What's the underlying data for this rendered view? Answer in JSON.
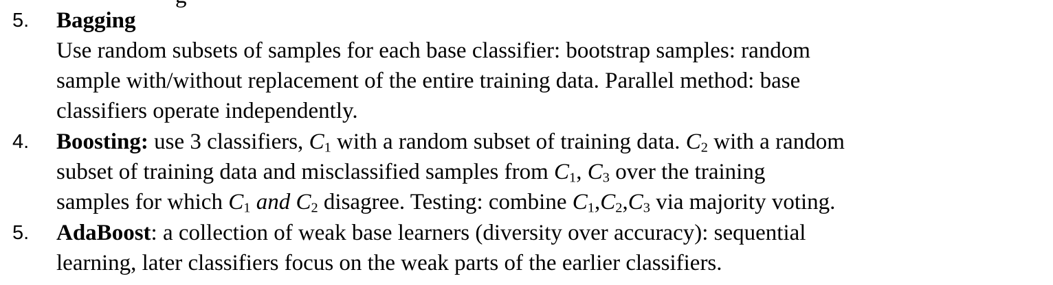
{
  "fragment": "g",
  "items": [
    {
      "number": "5.",
      "title": "Bagging",
      "lines": [
        "Use random subsets of samples for each base classifier: bootstrap samples: random",
        "sample with/without replacement of the entire training data. Parallel method: base",
        "classifiers operate independently."
      ]
    },
    {
      "number": "4.",
      "title": "Boosting:",
      "line1_text_a": " use 3 classifiers, ",
      "c": "C",
      "s1": "1",
      "s2": "2",
      "s3": "3",
      "line1_text_b": " with a random subset of training data. ",
      "line1_text_c": " with a random",
      "line2_text_a": "subset of training data  and misclassified samples from ",
      "comma": ", ",
      "line2_text_b": " over the training",
      "line3_text_a": "samples for which ",
      "and_word": " and ",
      "line3_text_b": " disagree. Testing: combine ",
      "comma_tight": ",",
      "line3_text_c": " via majority voting."
    },
    {
      "number": "5.",
      "title": "AdaBoost",
      "line1_rest": ": a collection of weak base learners (diversity over accuracy): sequential",
      "line2": "learning, later classifiers focus on the weak parts of the earlier classifiers."
    }
  ]
}
